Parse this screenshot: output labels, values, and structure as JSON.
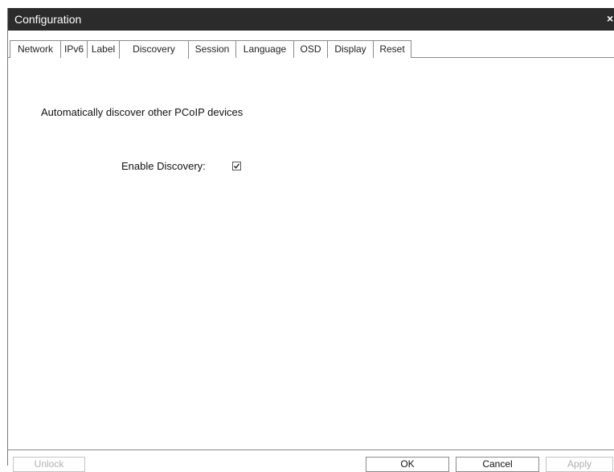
{
  "window": {
    "title": "Configuration",
    "close_glyph": "×"
  },
  "tabs": [
    {
      "label": "Network"
    },
    {
      "label": "IPv6"
    },
    {
      "label": "Label"
    },
    {
      "label": "Discovery",
      "active": true
    },
    {
      "label": "Session"
    },
    {
      "label": "Language"
    },
    {
      "label": "OSD"
    },
    {
      "label": "Display"
    },
    {
      "label": "Reset"
    }
  ],
  "discovery": {
    "heading": "Automatically discover other PCoIP devices",
    "enable_label": "Enable Discovery:",
    "enable_checked": true
  },
  "buttons": {
    "unlock": "Unlock",
    "ok": "OK",
    "cancel": "Cancel",
    "apply": "Apply"
  }
}
